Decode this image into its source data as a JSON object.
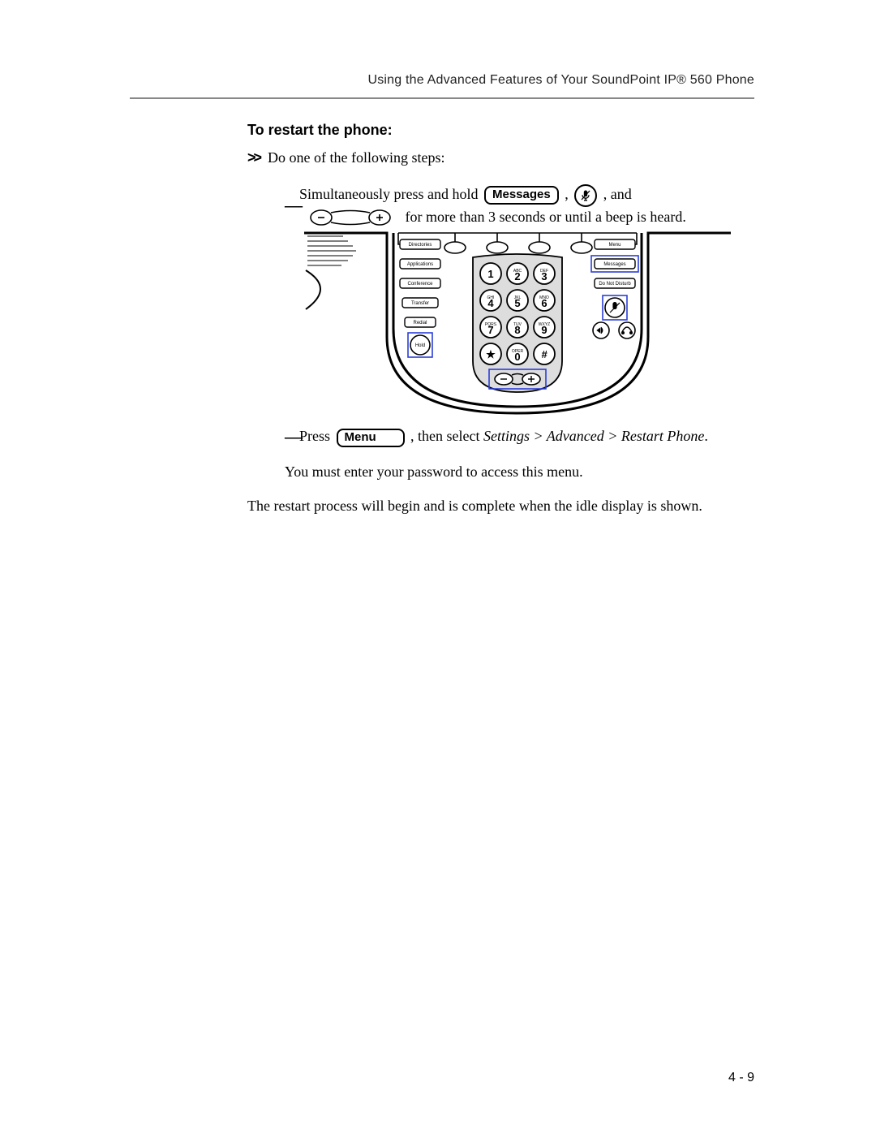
{
  "header": {
    "running_head": "Using the Advanced Features of Your SoundPoint IP® 560 Phone"
  },
  "section": {
    "title": "To restart the phone:",
    "intro_marker": ">>",
    "intro": "Do one of the following steps:"
  },
  "step1": {
    "pre": "Simultaneously press and hold ",
    "btn_messages": "Messages",
    "mid1": " , ",
    "mid2": " , and",
    "line2_tail": " for more than 3 seconds or until a beep is heard."
  },
  "step2": {
    "pre": "Press ",
    "btn_menu": "Menu",
    "mid": " , then select ",
    "path": "Settings > Advanced > Restart Phone",
    "period": "."
  },
  "after": {
    "pwd": "You must enter your password to access this menu.",
    "final": "The restart process will begin and is complete when the idle display is shown."
  },
  "phone": {
    "left_buttons": [
      "Directories",
      "Applications",
      "Conference",
      "Transfer",
      "Redial"
    ],
    "hold": "Hold",
    "right_buttons": [
      "Menu",
      "Messages",
      "Do Not Disturb"
    ],
    "keys": {
      "1": {
        "d": "1",
        "s": ""
      },
      "2": {
        "d": "2",
        "s": "ABC"
      },
      "3": {
        "d": "3",
        "s": "DEF"
      },
      "4": {
        "d": "4",
        "s": "GHI"
      },
      "5": {
        "d": "5",
        "s": "JKL"
      },
      "6": {
        "d": "6",
        "s": "MNO"
      },
      "7": {
        "d": "7",
        "s": "PQRS"
      },
      "8": {
        "d": "8",
        "s": "TUV"
      },
      "9": {
        "d": "9",
        "s": "WXYZ"
      },
      "0": {
        "d": "0",
        "s": "OPER"
      },
      "star": {
        "d": "★",
        "s": ""
      },
      "pound": {
        "d": "#",
        "s": ""
      }
    }
  },
  "footer": {
    "page": "4 - 9"
  }
}
